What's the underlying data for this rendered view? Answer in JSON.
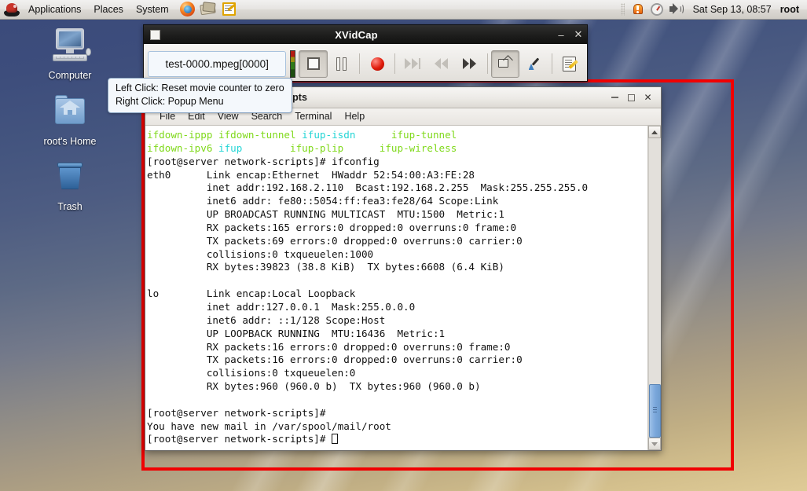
{
  "panel": {
    "menus": [
      "Applications",
      "Places",
      "System"
    ],
    "launchers": [
      "firefox-icon",
      "evolution-icon",
      "text-editor-icon"
    ],
    "tray": [
      "alert-icon",
      "system-monitor-icon",
      "volume-icon"
    ],
    "clock": "Sat Sep 13, 08:57",
    "user": "root"
  },
  "desktop": {
    "icons": [
      {
        "label": "Computer",
        "icon": "computer-icon"
      },
      {
        "label": "root's Home",
        "icon": "home-folder-icon"
      },
      {
        "label": "Trash",
        "icon": "trash-icon"
      }
    ],
    "capture_frame_color": "#f00002"
  },
  "xvidcap": {
    "title": "XVidCap",
    "filename": "test-0000.mpeg[0000]",
    "window_buttons": {
      "minimize": "–",
      "close": "✕"
    },
    "toolbar": [
      {
        "name": "stop-button",
        "label": "Stop",
        "state": "pressed"
      },
      {
        "name": "pause-button",
        "label": "Pause",
        "state": "normal"
      },
      {
        "name": "record-button",
        "label": "Record",
        "state": "normal"
      },
      {
        "name": "skip-to-end-button",
        "label": "Skip to end",
        "state": "disabled"
      },
      {
        "name": "step-back-button",
        "label": "Step back",
        "state": "disabled"
      },
      {
        "name": "step-forward-button",
        "label": "Step forward",
        "state": "normal"
      },
      {
        "name": "select-window-button",
        "label": "Select window",
        "state": "pressed"
      },
      {
        "name": "color-picker-button",
        "label": "Pick color",
        "state": "normal"
      },
      {
        "name": "preferences-button",
        "label": "Preferences",
        "state": "normal"
      }
    ]
  },
  "tooltip": {
    "line1": "Left Click: Reset movie counter to zero",
    "line2": "Right Click: Popup Menu"
  },
  "terminal": {
    "title": "er:/etc/sysconfig/network-scripts",
    "menu": [
      "File",
      "Edit",
      "View",
      "Search",
      "Terminal",
      "Help"
    ],
    "window_buttons": {
      "minimize": "minimize-icon",
      "maximize": "maximize-icon",
      "close": "✕"
    },
    "colors": {
      "green": "#7fd91a",
      "cyan": "#23d5d5",
      "foreground": "#111111",
      "background": "#ffffff"
    },
    "listing_rows": [
      [
        {
          "text": "ifdown-ippp",
          "color": "green"
        },
        {
          "text": "ifdown-tunnel",
          "color": "green"
        },
        {
          "text": "ifup-isdn",
          "color": "cyan"
        },
        {
          "text": "ifup-tunnel",
          "color": "green"
        }
      ],
      [
        {
          "text": "ifdown-ipv6",
          "color": "green"
        },
        {
          "text": "ifup",
          "color": "cyan"
        },
        {
          "text": "ifup-plip",
          "color": "green"
        },
        {
          "text": "ifup-wireless",
          "color": "green"
        }
      ]
    ],
    "output_lines": [
      "[root@server network-scripts]# ifconfig",
      "eth0      Link encap:Ethernet  HWaddr 52:54:00:A3:FE:28",
      "          inet addr:192.168.2.110  Bcast:192.168.2.255  Mask:255.255.255.0",
      "          inet6 addr: fe80::5054:ff:fea3:fe28/64 Scope:Link",
      "          UP BROADCAST RUNNING MULTICAST  MTU:1500  Metric:1",
      "          RX packets:165 errors:0 dropped:0 overruns:0 frame:0",
      "          TX packets:69 errors:0 dropped:0 overruns:0 carrier:0",
      "          collisions:0 txqueuelen:1000",
      "          RX bytes:39823 (38.8 KiB)  TX bytes:6608 (6.4 KiB)",
      "",
      "lo        Link encap:Local Loopback",
      "          inet addr:127.0.0.1  Mask:255.0.0.0",
      "          inet6 addr: ::1/128 Scope:Host",
      "          UP LOOPBACK RUNNING  MTU:16436  Metric:1",
      "          RX packets:16 errors:0 dropped:0 overruns:0 frame:0",
      "          TX packets:16 errors:0 dropped:0 overruns:0 carrier:0",
      "          collisions:0 txqueuelen:0",
      "          RX bytes:960 (960.0 b)  TX bytes:960 (960.0 b)",
      "",
      "[root@server network-scripts]#",
      "You have new mail in /var/spool/mail/root"
    ],
    "prompt_last": "[root@server network-scripts]# "
  }
}
